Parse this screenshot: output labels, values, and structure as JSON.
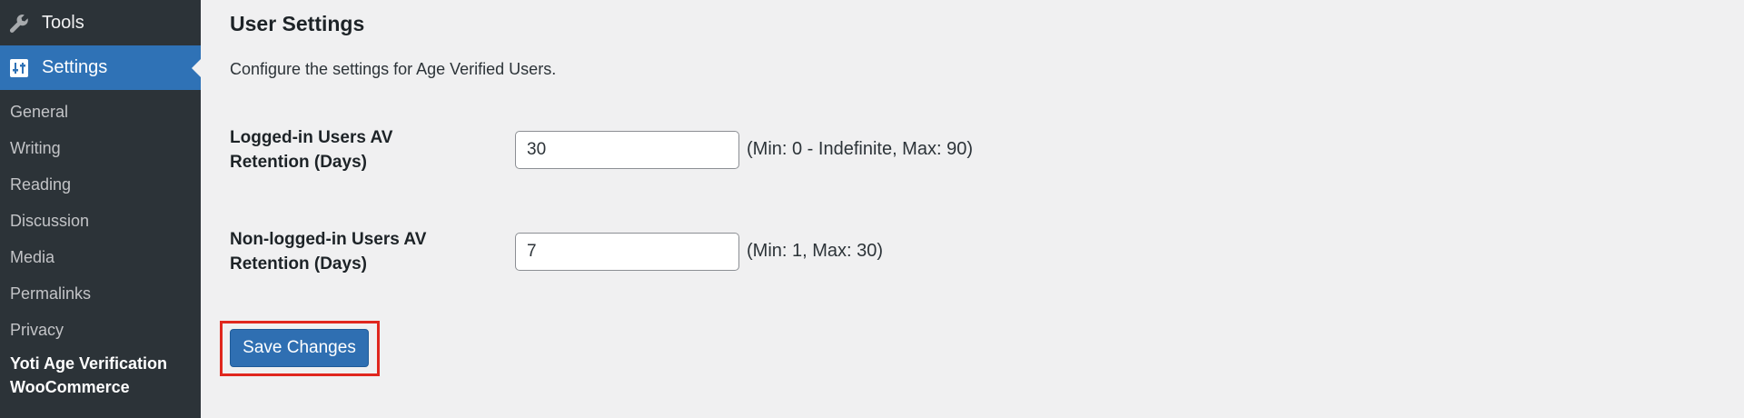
{
  "sidebar": {
    "tools_label": "Tools",
    "settings_label": "Settings",
    "submenu": [
      {
        "label": "General"
      },
      {
        "label": "Writing"
      },
      {
        "label": "Reading"
      },
      {
        "label": "Discussion"
      },
      {
        "label": "Media"
      },
      {
        "label": "Permalinks"
      },
      {
        "label": "Privacy"
      },
      {
        "label": "Yoti Age Verification WooCommerce"
      }
    ]
  },
  "main": {
    "title": "User Settings",
    "description": "Configure the settings for Age Verified Users.",
    "fields": [
      {
        "label": "Logged-in Users AV Retention (Days)",
        "value": "30",
        "hint": "(Min: 0 - Indefinite, Max: 90)"
      },
      {
        "label": "Non-logged-in Users AV Retention (Days)",
        "value": "7",
        "hint": "(Min: 1, Max: 30)"
      }
    ],
    "save_label": "Save Changes"
  },
  "colors": {
    "sidebar_bg": "#2c3338",
    "active_menu": "#2f72b6",
    "button": "#2f6fb2",
    "highlight": "#e0271e"
  },
  "icons": {
    "tools": "wrench-icon",
    "settings": "settings-sliders-icon"
  }
}
